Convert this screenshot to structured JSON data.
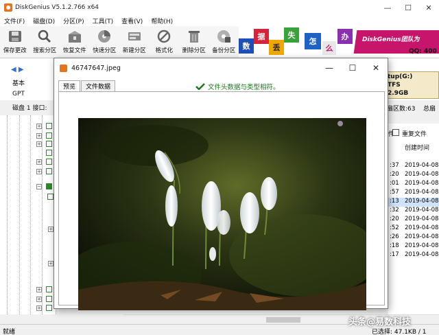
{
  "app": {
    "title": "DiskGenius V5.1.2.766 x64",
    "window_controls": [
      "—",
      "☐",
      "✕"
    ]
  },
  "menu": [
    "文件(F)",
    "磁盘(D)",
    "分区(P)",
    "工具(T)",
    "查看(V)",
    "帮助(H)"
  ],
  "toolbar": [
    {
      "label": "保存更改",
      "icon": "save-disk-icon"
    },
    {
      "label": "搜索分区",
      "icon": "magnifier-icon"
    },
    {
      "label": "恢复文件",
      "icon": "recover-box-icon"
    },
    {
      "label": "快速分区",
      "icon": "quick-partition-disc-icon"
    },
    {
      "label": "新建分区",
      "icon": "new-partition-icon"
    },
    {
      "label": "格式化",
      "icon": "format-icon"
    },
    {
      "label": "删除分区",
      "icon": "trash-icon"
    },
    {
      "label": "备份分区",
      "icon": "backup-disc-icon"
    }
  ],
  "banner": {
    "tiles": [
      "数",
      "据",
      "丢",
      "失",
      "怎",
      "么",
      "办"
    ],
    "slogan": "DiskGenius团队为",
    "qq": "QQ: 400"
  },
  "disk_panel": {
    "label_basic": "基本",
    "label_gpt": "GPT",
    "disk_line": "磁盘 1 接口:",
    "partition_name": "tup(G:)",
    "partition_fs": "TFS",
    "partition_size": "2.9GB",
    "sector_info": "扇区数:63",
    "total_label": "总扇"
  },
  "file_list": {
    "duplicate_label": "重复文件",
    "created_header": "创建时间",
    "rows": [
      {
        "time": ":37",
        "date": "2019-04-08",
        "selected": false
      },
      {
        "time": ":20",
        "date": "2019-04-08",
        "selected": false
      },
      {
        "time": ":01",
        "date": "2019-04-08",
        "selected": false
      },
      {
        "time": ":57",
        "date": "2019-04-08",
        "selected": false
      },
      {
        "time": ":13",
        "date": "2019-04-08",
        "selected": true
      },
      {
        "time": ":32",
        "date": "2019-04-08",
        "selected": false
      },
      {
        "time": ":20",
        "date": "2019-04-08",
        "selected": false
      },
      {
        "time": ":52",
        "date": "2019-04-08",
        "selected": false
      },
      {
        "time": ":26",
        "date": "2019-04-08",
        "selected": false
      },
      {
        "time": ":18",
        "date": "2019-04-08",
        "selected": false
      },
      {
        "time": ":17",
        "date": "2019-04-08",
        "selected": false
      }
    ]
  },
  "status": {
    "left": "就绪",
    "right": "已选择: 47.1KB / 1"
  },
  "dialog": {
    "title": "46747647.jpeg",
    "tabs": [
      "预览",
      "文件数据"
    ],
    "active_tab": "预览",
    "signature_status": "文件头数据与类型相符。",
    "preview_subject": "white snowdrop flowers in grass"
  },
  "watermark": "头条@易数科技",
  "colors": {
    "accent_orange": "#e8731d",
    "status_green": "#1a7a1a",
    "banner_magenta": "#c8156c",
    "selected_row": "#cfe3f8"
  }
}
